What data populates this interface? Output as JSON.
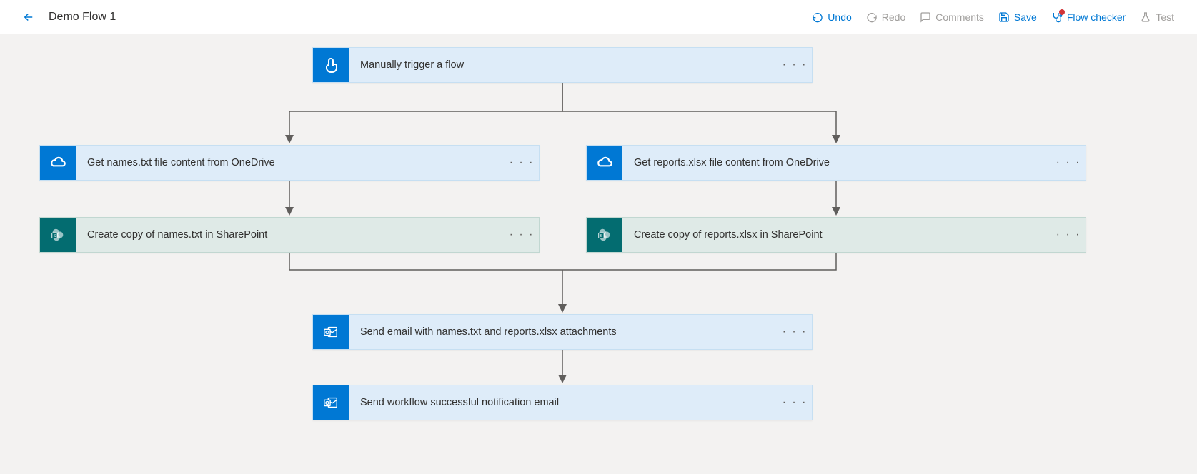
{
  "header": {
    "title": "Demo Flow 1",
    "tools": {
      "undo": "Undo",
      "redo": "Redo",
      "comments": "Comments",
      "save": "Save",
      "flow_checker": "Flow checker",
      "test": "Test"
    }
  },
  "flow": {
    "trigger": {
      "label": "Manually trigger a flow",
      "icon": "touch"
    },
    "branchA": [
      {
        "label": "Get names.txt file content from OneDrive",
        "icon": "onedrive"
      },
      {
        "label": "Create copy of names.txt in SharePoint",
        "icon": "sharepoint"
      }
    ],
    "branchB": [
      {
        "label": "Get reports.xlsx file content from OneDrive",
        "icon": "onedrive"
      },
      {
        "label": "Create copy of reports.xlsx in SharePoint",
        "icon": "sharepoint"
      }
    ],
    "tail": [
      {
        "label": "Send email with names.txt and reports.xlsx attachments",
        "icon": "outlook"
      },
      {
        "label": "Send workflow successful notification email",
        "icon": "outlook"
      }
    ]
  }
}
